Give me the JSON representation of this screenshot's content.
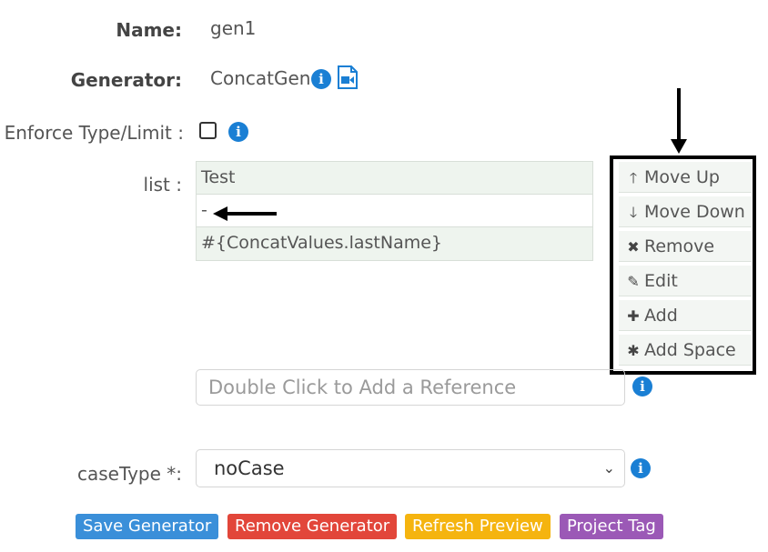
{
  "form": {
    "name_label": "Name:",
    "name_value": "gen1",
    "generator_label": "Generator:",
    "generator_value": "ConcatGen",
    "enforce_label": "Enforce Type/Limit :",
    "list_label": "list :",
    "list_items": [
      "Test",
      "-",
      "#{ConcatValues.lastName}"
    ],
    "reference_placeholder": "Double Click to Add a Reference",
    "casetype_label": "caseType *:",
    "casetype_value": "noCase"
  },
  "context_menu": {
    "items": [
      {
        "label": "Move Up",
        "icon": "arrow-up-icon"
      },
      {
        "label": "Move Down",
        "icon": "arrow-down-icon"
      },
      {
        "label": "Remove",
        "icon": "times-icon"
      },
      {
        "label": "Edit",
        "icon": "pencil-icon"
      },
      {
        "label": "Add",
        "icon": "plus-icon"
      },
      {
        "label": "Add Space",
        "icon": "asterisk-icon"
      }
    ]
  },
  "buttons": {
    "save": "Save Generator",
    "remove": "Remove Generator",
    "refresh": "Refresh Preview",
    "project_tag": "Project Tag"
  },
  "colors": {
    "save": "#3a8fd9",
    "remove": "#e2463a",
    "refresh": "#f5b40f",
    "project_tag": "#9b59b6",
    "info": "#1a7fd4"
  }
}
